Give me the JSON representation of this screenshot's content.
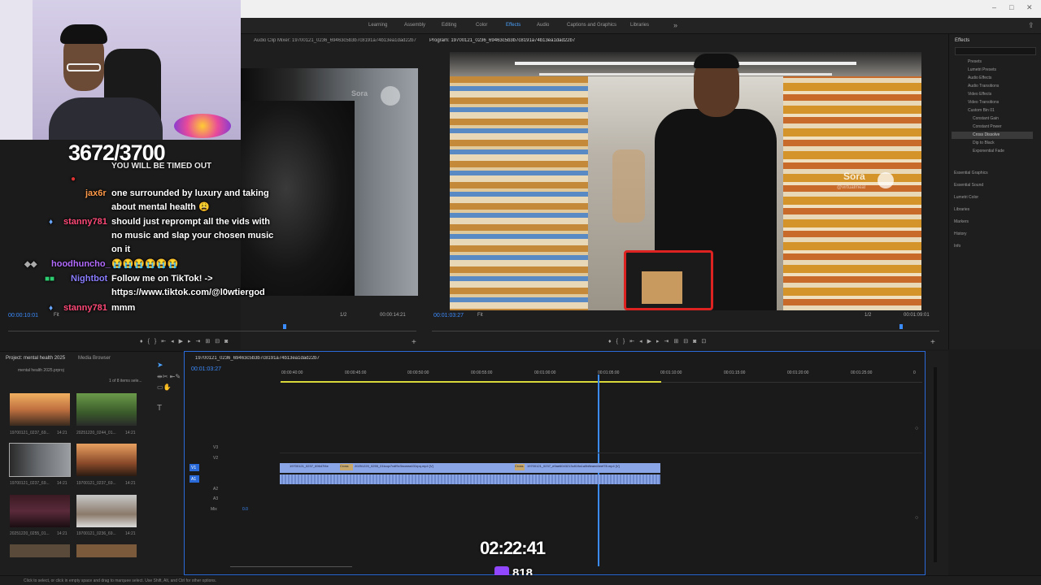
{
  "window": {
    "minimize": "–",
    "maximize": "□",
    "close": "✕"
  },
  "workspaces": [
    "Learning",
    "Assembly",
    "Editing",
    "Color",
    "Effects",
    "Audio",
    "Captions and Graphics",
    "Libraries"
  ],
  "active_workspace": "Effects",
  "source_panel": {
    "tab": "Audio Clip Mixer: 19700121_0236_69463c5b3b7c8191a74b13ea1dad22b7",
    "timecode": "00:00:10:01",
    "fit": "Fit",
    "ratio": "1/2",
    "duration": "00:00:14:21",
    "watermark": "Sora"
  },
  "program_panel": {
    "tab": "Program: 19700121_0236_69463c5b3b7c8191a74b13ea1dad22b7",
    "timecode": "00:01:03:27",
    "fit": "Fit",
    "ratio": "1/2",
    "duration": "00:01:09:01",
    "watermark": "Sora",
    "watermark_handle": "@virtualmeal"
  },
  "stream_overlay": {
    "counter": "3672/3700",
    "timed_out": "YOU WILL BE TIMED OUT",
    "chat": [
      {
        "user": "jax6r",
        "msg": "one surrounded by luxury and taking"
      },
      {
        "user": "",
        "msg": "about mental health 😩"
      },
      {
        "user": "stanny781",
        "msg": "should just reprompt all the vids with"
      },
      {
        "user": "",
        "msg": "no music and slap your chosen music"
      },
      {
        "user": "",
        "msg": "on it"
      },
      {
        "user": "hoodhuncho_",
        "msg": "😭😭😭😭😭😭"
      },
      {
        "user": "Nightbot",
        "msg": "Follow me on TikTok! ->"
      },
      {
        "user": "",
        "msg": "https://www.tiktok.com/@l0wtiergod"
      },
      {
        "user": "stanny781",
        "msg": "mmm"
      }
    ],
    "stream_timer": "02:22:41",
    "viewers": "818"
  },
  "project_panel": {
    "tab_project": "Project: mental health 2025",
    "tab_media": "Media Browser",
    "file": "mental health 2025.prproj",
    "items_count": "1 of 8 items sele...",
    "thumbs": [
      {
        "name": "19700121_0237_69...",
        "dur": "14:21"
      },
      {
        "name": "20251220_0244_01...",
        "dur": "14:21"
      },
      {
        "name": "19700121_0237_69...",
        "dur": "14:21"
      },
      {
        "name": "19700121_0237_69...",
        "dur": "14:21"
      },
      {
        "name": "20251220_0255_01...",
        "dur": "14:21"
      },
      {
        "name": "19700121_0236_69...",
        "dur": "14:21"
      }
    ]
  },
  "timeline": {
    "tab": "19700121_0236_69463c5b3b7c8191a74b13ea1dad22b7",
    "timecode": "00:01:03:27",
    "ruler": [
      "00:00:40:00",
      "00:00:45:00",
      "00:00:50:00",
      "00:00:55:00",
      "00:01:00:00",
      "00:01:05:00",
      "00:01:10:00",
      "00:01:15:00",
      "00:01:20:00",
      "00:01:25:00",
      "0"
    ],
    "tracks": [
      "V3",
      "V2",
      "V1",
      "A1",
      "A2",
      "A3",
      "Mix"
    ],
    "mix_value": "0.0",
    "clips": [
      {
        "label": "19700121_0237_69647f4e",
        "color": "#8aa6e6"
      },
      {
        "label": "20251220_0255_01kcqv7vdf9v3ncwea431rpq.mp4 [V]",
        "color": "#8aa6e6"
      },
      {
        "label": "19700121_0237_e9ae6043213c819a1a0b8eaed4eef78.mp4 [V]",
        "color": "#8aa6e6"
      }
    ],
    "transition_label": "Cross"
  },
  "effects_panel": {
    "title": "Effects",
    "tree": [
      "Presets",
      "Lumetri Presets",
      "Audio Effects",
      "Audio Transitions",
      "Video Effects",
      "Video Transitions",
      "Custom Bin 01",
      "Constant Gain",
      "Constant Power",
      "Cross Dissolve",
      "Dip to Black",
      "Exponential Fade"
    ],
    "sections": [
      "Essential Graphics",
      "Essential Sound",
      "Lumetri Color",
      "Libraries",
      "Markers",
      "History",
      "Info"
    ]
  },
  "status_bar": "Click to select, or click in empty space and drag to marquee select. Use Shift, Alt, and Ctrl for other options.",
  "colors": {
    "accent": "#3b8cff",
    "twitch": "#9146ff",
    "clip": "#8aa6e6"
  }
}
